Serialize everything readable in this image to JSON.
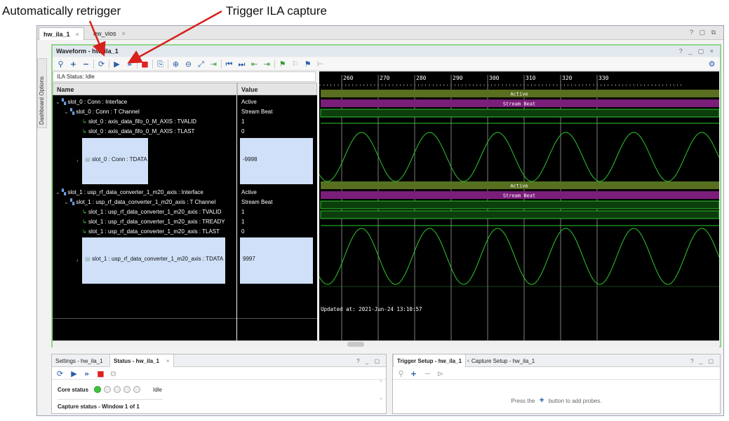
{
  "annotations": {
    "retrigger": "Automatically retrigger",
    "capture": "Trigger ILA capture"
  },
  "tabs": [
    {
      "label": "hw_ila_1"
    },
    {
      "label": "hw_vios"
    }
  ],
  "window_controls": "? ▢ ⧉",
  "side_panel": "Dashboard Options",
  "waveform": {
    "title": "Waveform - hw_ila_1",
    "controls": "? _ ▢ ×",
    "ila_status": "ILA Status: Idle",
    "col_name": "Name",
    "col_value": "Value",
    "rows": [
      {
        "name": "slot_0 : Conn : Interface",
        "value": "Active"
      },
      {
        "name": "slot_0 : Conn : T Channel",
        "value": "Stream Beat"
      },
      {
        "name": "slot_0 : axis_data_fifo_0_M_AXIS : TVALID",
        "value": "1"
      },
      {
        "name": "slot_0 : axis_data_fifo_0_M_AXIS : TLAST",
        "value": "0"
      },
      {
        "name": "slot_0 : Conn : TDATA",
        "value": "-9998"
      },
      {
        "name": "slot_1 : usp_rf_data_converter_1_m20_axis : Interface",
        "value": "Active"
      },
      {
        "name": "slot_1 : usp_rf_data_converter_1_m20_axis : T Channel",
        "value": "Stream Beat"
      },
      {
        "name": "slot_1 : usp_rf_data_converter_1_m20_axis : TVALID",
        "value": "1"
      },
      {
        "name": "slot_1 : usp_rf_data_converter_1_m20_axis : TREADY",
        "value": "1"
      },
      {
        "name": "slot_1 : usp_rf_data_converter_1_m20_axis : TLAST",
        "value": "0"
      },
      {
        "name": "slot_1 : usp_rf_data_converter_1_m20_axis : TDATA",
        "value": "9997"
      }
    ],
    "ticks": [
      "260",
      "270",
      "280",
      "290",
      "300",
      "310",
      "320",
      "330"
    ],
    "bus_labels": {
      "active": "Active",
      "stream": "Stream Beat"
    },
    "updated": "Updated at: 2021-Jun-24 13:10:57"
  },
  "settings_panel": {
    "tab1": "Settings - hw_ila_1",
    "tab2": "Status - hw_ila_1",
    "controls": "? _ ▢",
    "core_status_label": "Core status",
    "core_status_value": "Idle",
    "capture_status": "Capture status -  Window 1 of 1"
  },
  "trigger_panel": {
    "tab1": "Trigger Setup - hw_ila_1",
    "tab2": "Capture Setup - hw_ila_1",
    "controls": "? _ ▢",
    "hint_before": "Press the",
    "hint_after": "button to add probes."
  },
  "colors": {
    "active_bus": "#5a6e1f",
    "stream_bus": "#7a1e7a",
    "signal_green": "#2fc82f",
    "highlight": "#cfe0f8",
    "pane_border": "#8fd68a"
  }
}
